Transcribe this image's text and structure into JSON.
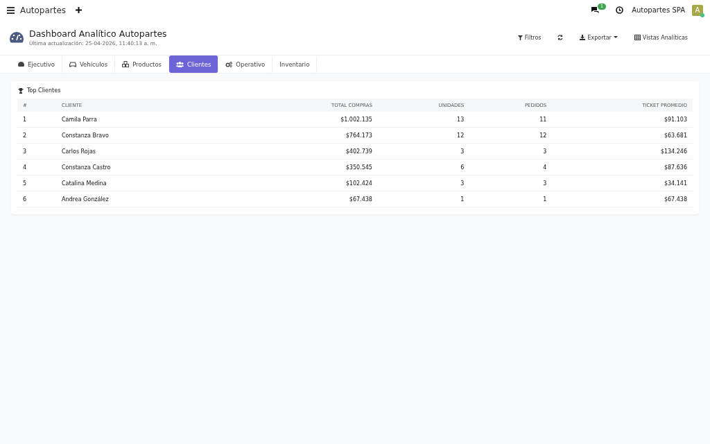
{
  "topbar": {
    "brand": "Autopartes",
    "notification_count": "1",
    "company": "Autopartes SPA",
    "avatar_letter": "A",
    "avatar_online": true
  },
  "header": {
    "title": "Dashboard Analítico Autopartes",
    "subtitle": "Última actualización: 25-04-2026, 11:40:13 a. m.",
    "actions": [
      {
        "kind": "filter",
        "label": "Filtros"
      },
      {
        "kind": "refresh"
      },
      {
        "kind": "export",
        "label": "Exportar"
      },
      {
        "kind": "views",
        "label": "Vistas Analíticas"
      }
    ]
  },
  "tabs": [
    {
      "kind": "gauge",
      "label": "Ejecutivo",
      "selected": false
    },
    {
      "kind": "car",
      "label": "Vehículos",
      "selected": false
    },
    {
      "kind": "cubes",
      "label": "Productos",
      "selected": false
    },
    {
      "kind": "users",
      "label": "Clientes",
      "selected": true
    },
    {
      "kind": "gears",
      "label": "Operativo",
      "selected": false
    },
    {
      "kind": "none",
      "label": "Inventario",
      "selected": false
    }
  ],
  "card": {
    "title": "Top Clientes",
    "table": {
      "columns": [
        "#",
        "CLIENTE",
        "TOTAL COMPRAS",
        "UNIDADES",
        "PEDIDOS",
        "TICKET PROMEDIO"
      ],
      "rows": [
        [
          "1",
          "Camila Parra",
          "$1.002.135",
          "13",
          "11",
          "$91.103"
        ],
        [
          "2",
          "Constanza Bravo",
          "$764.173",
          "12",
          "12",
          "$63.681"
        ],
        [
          "3",
          "Carlos Rojas",
          "$402.739",
          "3",
          "3",
          "$134.246"
        ],
        [
          "4",
          "Constanza Castro",
          "$350.545",
          "6",
          "4",
          "$87.636"
        ],
        [
          "5",
          "Catalina Medina",
          "$102.424",
          "3",
          "3",
          "$34.141"
        ],
        [
          "6",
          "Andrea González",
          "$67.438",
          "1",
          "1",
          "$67.438"
        ]
      ]
    }
  }
}
